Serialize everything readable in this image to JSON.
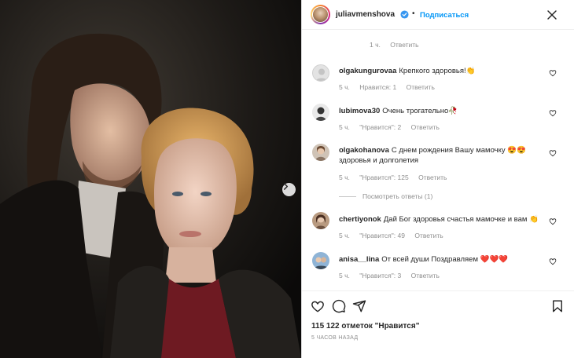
{
  "header": {
    "username": "juliavmenshova",
    "follow_label": "Подписаться",
    "dot": "•"
  },
  "top_meta": {
    "time": "1 ч.",
    "reply": "Ответить"
  },
  "comments": [
    {
      "user": "olgakungurovaa",
      "text": "Крепкого здоровья!👏",
      "time": "5 ч.",
      "likes": "Нравится: 1",
      "reply": "Ответить"
    },
    {
      "user": "lubimova30",
      "text": "Очень трогательно🥀",
      "time": "5 ч.",
      "likes": "\"Нравится\": 2",
      "reply": "Ответить"
    },
    {
      "user": "olgakohanova",
      "text": "С днем рождения Вашу мамочку 😍😍 здоровья и долголетия",
      "time": "5 ч.",
      "likes": "\"Нравится\": 125",
      "reply": "Ответить",
      "view_replies": "Посмотреть ответы (1)"
    },
    {
      "user": "chertiyonok",
      "text": "Дай Бог здоровья счастья мамочке и вам 👏",
      "time": "5 ч.",
      "likes": "\"Нравится\": 49",
      "reply": "Ответить"
    },
    {
      "user": "anisa__lina",
      "text": "От всей души Поздравляем ❤️❤️❤️",
      "time": "5 ч.",
      "likes": "\"Нравится\": 3",
      "reply": "Ответить"
    }
  ],
  "post": {
    "likes": "115 122 отметок \"Нравится\"",
    "posted": "5 ЧАСОВ НАЗАД"
  },
  "colors": {
    "accent": "#0095f6",
    "text": "#262626",
    "muted": "#8e8e8e",
    "verified": "#3897f0"
  }
}
